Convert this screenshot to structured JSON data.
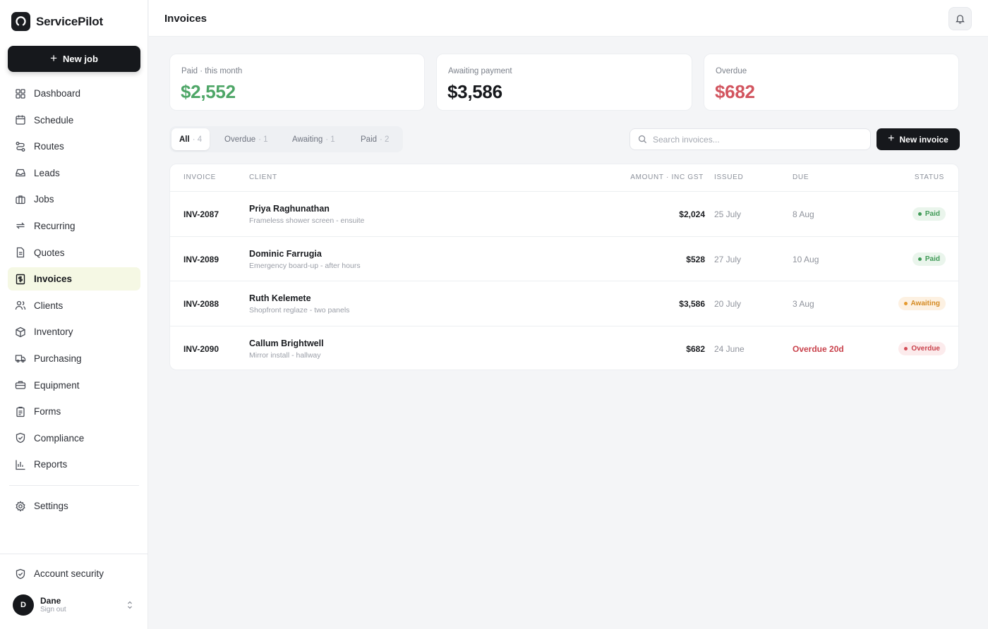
{
  "brand": {
    "name": "ServicePilot"
  },
  "sidebar": {
    "new_job_label": "New job",
    "items": [
      {
        "label": "Dashboard",
        "icon": "grid-icon"
      },
      {
        "label": "Schedule",
        "icon": "calendar-icon"
      },
      {
        "label": "Routes",
        "icon": "route-icon"
      },
      {
        "label": "Leads",
        "icon": "inbox-icon"
      },
      {
        "label": "Jobs",
        "icon": "briefcase-icon"
      },
      {
        "label": "Recurring",
        "icon": "repeat-icon"
      },
      {
        "label": "Quotes",
        "icon": "document-icon"
      },
      {
        "label": "Invoices",
        "icon": "dollar-receipt-icon",
        "active": true
      },
      {
        "label": "Clients",
        "icon": "users-icon"
      },
      {
        "label": "Inventory",
        "icon": "box-icon"
      },
      {
        "label": "Purchasing",
        "icon": "truck-icon"
      },
      {
        "label": "Equipment",
        "icon": "toolbox-icon"
      },
      {
        "label": "Forms",
        "icon": "clipboard-icon"
      },
      {
        "label": "Compliance",
        "icon": "shield-check-icon"
      },
      {
        "label": "Reports",
        "icon": "bar-chart-icon"
      }
    ],
    "settings_label": "Settings",
    "account_security_label": "Account security",
    "user": {
      "initial": "D",
      "name": "Dane",
      "action": "Sign out"
    }
  },
  "header": {
    "title": "Invoices"
  },
  "stats": {
    "paid": {
      "label": "Paid · this month",
      "value": "$2,552",
      "color": "#4ea667"
    },
    "awaiting": {
      "label": "Awaiting payment",
      "value": "$3,586",
      "color": "#16181c"
    },
    "overdue": {
      "label": "Overdue",
      "value": "$682",
      "color": "#d2555f"
    }
  },
  "filters": [
    {
      "label": "All",
      "count": "· 4",
      "active": true
    },
    {
      "label": "Overdue",
      "count": "· 1"
    },
    {
      "label": "Awaiting",
      "count": "· 1"
    },
    {
      "label": "Paid",
      "count": "· 2"
    }
  ],
  "search": {
    "placeholder": "Search invoices..."
  },
  "new_invoice_label": "New invoice",
  "table": {
    "columns": {
      "invoice": "INVOICE",
      "client": "CLIENT",
      "amount": "AMOUNT · INC GST",
      "issued": "ISSUED",
      "due": "DUE",
      "status": "STATUS"
    },
    "rows": [
      {
        "invoice": "INV-2087",
        "client": "Priya Raghunathan",
        "description": "Frameless shower screen - ensuite",
        "amount": "$2,024",
        "issued": "25 July",
        "due": "8 Aug",
        "status": "Paid",
        "status_kind": "paid"
      },
      {
        "invoice": "INV-2089",
        "client": "Dominic Farrugia",
        "description": "Emergency board-up - after hours",
        "amount": "$528",
        "issued": "27 July",
        "due": "10 Aug",
        "status": "Paid",
        "status_kind": "paid"
      },
      {
        "invoice": "INV-2088",
        "client": "Ruth Kelemete",
        "description": "Shopfront reglaze - two panels",
        "amount": "$3,586",
        "issued": "20 July",
        "due": "3 Aug",
        "status": "Awaiting",
        "status_kind": "awaiting"
      },
      {
        "invoice": "INV-2090",
        "client": "Callum Brightwell",
        "description": "Mirror install - hallway",
        "amount": "$682",
        "issued": "24 June",
        "due": "Overdue 20d",
        "due_overdue": true,
        "status": "Overdue",
        "status_kind": "overdue"
      }
    ]
  }
}
